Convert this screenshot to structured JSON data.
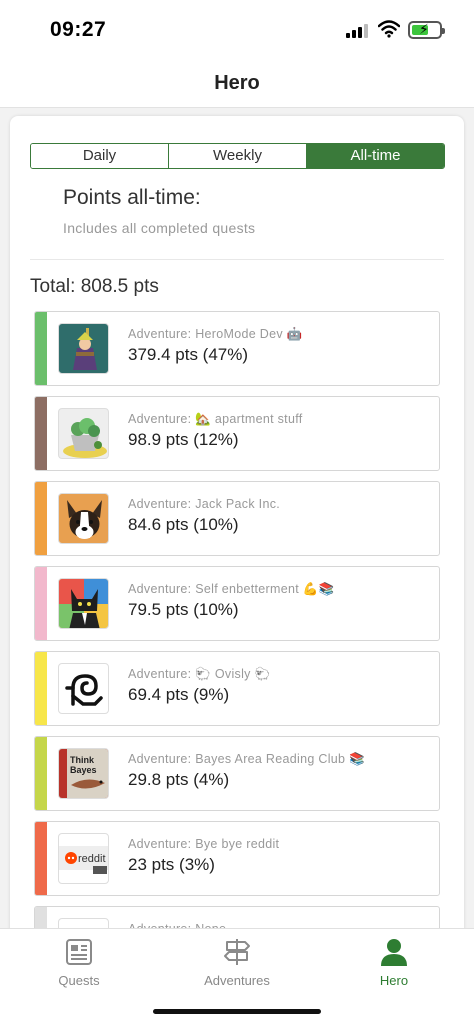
{
  "status_bar": {
    "time": "09:27"
  },
  "nav": {
    "title": "Hero"
  },
  "tabs": [
    {
      "label": "Daily",
      "active": false
    },
    {
      "label": "Weekly",
      "active": false
    },
    {
      "label": "All-time",
      "active": true
    }
  ],
  "heading": "Points all-time:",
  "subheading": "Includes all completed quests",
  "total": "Total: 808.5 pts",
  "adventures": [
    {
      "label": "Adventure: HeroMode Dev 🤖",
      "points": "379.4 pts (47%)",
      "color": "#6bbf6b",
      "icon": "wizard-avatar-icon"
    },
    {
      "label": "Adventure: 🏡 apartment stuff",
      "points": "98.9 pts (12%)",
      "color": "#8d6e63",
      "icon": "succulent-plant-icon"
    },
    {
      "label": "Adventure: Jack Pack Inc.",
      "points": "84.6 pts (10%)",
      "color": "#f0a040",
      "icon": "corgi-dog-icon"
    },
    {
      "label": "Adventure: Self enbetterment 💪📚",
      "points": "79.5 pts (10%)",
      "color": "#f2b8cc",
      "icon": "cat-in-suit-icon"
    },
    {
      "label": "Adventure: 🐑 Ovisly 🐑",
      "points": "69.4 pts (9%)",
      "color": "#f7e64a",
      "icon": "ram-glyph-icon"
    },
    {
      "label": "Adventure: Bayes Area Reading Club 📚",
      "points": "29.8 pts (4%)",
      "color": "#c5d64a",
      "icon": "think-bayes-book-icon"
    },
    {
      "label": "Adventure: Bye bye reddit",
      "points": "23 pts (3%)",
      "color": "#ef6a4a",
      "icon": "reddit-logo-icon"
    },
    {
      "label": "Adventure: None",
      "points": "",
      "color": "#e0e0e0",
      "icon": "blank-icon"
    }
  ],
  "tab_bar": [
    {
      "label": "Quests",
      "icon": "newspaper-icon",
      "active": false
    },
    {
      "label": "Adventures",
      "icon": "signpost-icon",
      "active": false
    },
    {
      "label": "Hero",
      "icon": "person-icon",
      "active": true
    }
  ]
}
